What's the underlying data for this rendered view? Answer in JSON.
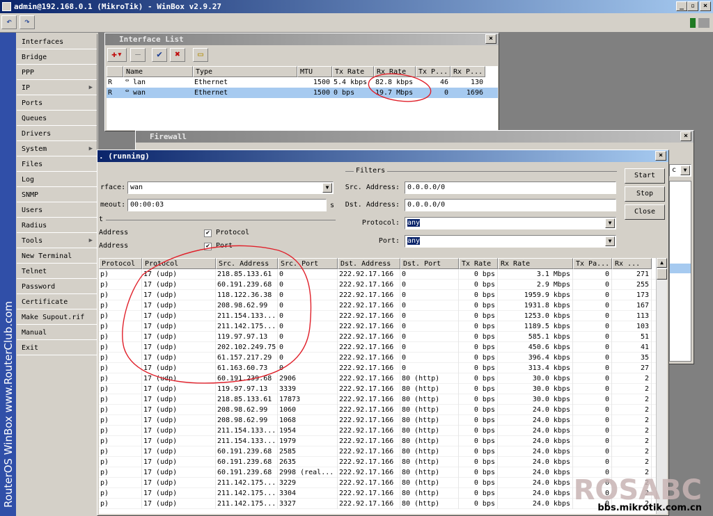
{
  "app": {
    "title": "admin@192.168.0.1 (MikroTik) - WinBox v2.9.27",
    "brand": "RouterOS WinBox  www.RouterClub.com",
    "watermark": "ROSABC",
    "watermark_url": "bbs.mikrotik.com.cn"
  },
  "sidebar": {
    "items": [
      {
        "label": "Interfaces",
        "sub": false
      },
      {
        "label": "Bridge",
        "sub": false
      },
      {
        "label": "PPP",
        "sub": false
      },
      {
        "label": "IP",
        "sub": true
      },
      {
        "label": "Ports",
        "sub": false
      },
      {
        "label": "Queues",
        "sub": false
      },
      {
        "label": "Drivers",
        "sub": false
      },
      {
        "label": "System",
        "sub": true
      },
      {
        "label": "Files",
        "sub": false
      },
      {
        "label": "Log",
        "sub": false
      },
      {
        "label": "SNMP",
        "sub": false
      },
      {
        "label": "Users",
        "sub": false
      },
      {
        "label": "Radius",
        "sub": false
      },
      {
        "label": "Tools",
        "sub": true
      },
      {
        "label": "New Terminal",
        "sub": false
      },
      {
        "label": "Telnet",
        "sub": false
      },
      {
        "label": "Password",
        "sub": false
      },
      {
        "label": "Certificate",
        "sub": false
      },
      {
        "label": "Make Supout.rif",
        "sub": false
      },
      {
        "label": "Manual",
        "sub": false
      },
      {
        "label": "Exit",
        "sub": false
      }
    ]
  },
  "interface_list": {
    "title": "Interface List",
    "columns": [
      "",
      "Name",
      "Type",
      "MTU",
      "Tx Rate",
      "Rx Rate",
      "Tx P...",
      "Rx P..."
    ],
    "rows": [
      [
        "R",
        "lan",
        "Ethernet",
        "1500",
        "5.4 kbps",
        "82.8 kbps",
        "46",
        "130"
      ],
      [
        "R",
        "wan",
        "Ethernet",
        "1500",
        "0 bps",
        "19.7 Mbps",
        "0",
        "1696"
      ]
    ],
    "selected_row": 1
  },
  "firewall": {
    "title": "Firewall",
    "side_select": "c"
  },
  "torch": {
    "title": ". (running)",
    "interface_label": "rface:",
    "interface_value": "wan",
    "timeout_label": "meout:",
    "timeout_value": "00:00:03",
    "timeout_unit": "s",
    "collect_label": "t",
    "collect_src": "Address",
    "collect_dst": "Address",
    "collect_protocol": "Protocol",
    "collect_port": "Port",
    "filters_label": "Filters",
    "src_address_label": "Src. Address:",
    "src_address_value": "0.0.0.0/0",
    "dst_address_label": "Dst. Address:",
    "dst_address_value": "0.0.0.0/0",
    "protocol_label": "Protocol:",
    "protocol_value": "any",
    "port_label": "Port:",
    "port_value": "any",
    "buttons": {
      "start": "Start",
      "stop": "Stop",
      "close": "Close"
    },
    "columns": [
      "Protocol",
      "Protocol",
      "Src. Address",
      "Src. Port",
      "Dst. Address",
      "Dst. Port",
      "Tx Rate",
      "Rx Rate",
      "Tx Pa...",
      "Rx ..."
    ],
    "rows": [
      [
        "p)",
        "17 (udp)",
        "218.85.133.61",
        "0",
        "222.92.17.166",
        "0",
        "0 bps",
        "3.1 Mbps",
        "0",
        "271"
      ],
      [
        "p)",
        "17 (udp)",
        "60.191.239.68",
        "0",
        "222.92.17.166",
        "0",
        "0 bps",
        "2.9 Mbps",
        "0",
        "255"
      ],
      [
        "p)",
        "17 (udp)",
        "118.122.36.38",
        "0",
        "222.92.17.166",
        "0",
        "0 bps",
        "1959.9 kbps",
        "0",
        "173"
      ],
      [
        "p)",
        "17 (udp)",
        "208.98.62.99",
        "0",
        "222.92.17.166",
        "0",
        "0 bps",
        "1931.8 kbps",
        "0",
        "167"
      ],
      [
        "p)",
        "17 (udp)",
        "211.154.133...",
        "0",
        "222.92.17.166",
        "0",
        "0 bps",
        "1253.0 kbps",
        "0",
        "113"
      ],
      [
        "p)",
        "17 (udp)",
        "211.142.175...",
        "0",
        "222.92.17.166",
        "0",
        "0 bps",
        "1189.5 kbps",
        "0",
        "103"
      ],
      [
        "p)",
        "17 (udp)",
        "119.97.97.13",
        "0",
        "222.92.17.166",
        "0",
        "0 bps",
        "585.1 kbps",
        "0",
        "51"
      ],
      [
        "p)",
        "17 (udp)",
        "202.102.249.75",
        "0",
        "222.92.17.166",
        "0",
        "0 bps",
        "450.6 kbps",
        "0",
        "41"
      ],
      [
        "p)",
        "17 (udp)",
        "61.157.217.29",
        "0",
        "222.92.17.166",
        "0",
        "0 bps",
        "396.4 kbps",
        "0",
        "35"
      ],
      [
        "p)",
        "17 (udp)",
        "61.163.60.73",
        "0",
        "222.92.17.166",
        "0",
        "0 bps",
        "313.4 kbps",
        "0",
        "27"
      ],
      [
        "p)",
        "17 (udp)",
        "60.191.239.68",
        "2906",
        "222.92.17.166",
        "80 (http)",
        "0 bps",
        "30.0 kbps",
        "0",
        "2"
      ],
      [
        "p)",
        "17 (udp)",
        "119.97.97.13",
        "3339",
        "222.92.17.166",
        "80 (http)",
        "0 bps",
        "30.0 kbps",
        "0",
        "2"
      ],
      [
        "p)",
        "17 (udp)",
        "218.85.133.61",
        "17873",
        "222.92.17.166",
        "80 (http)",
        "0 bps",
        "30.0 kbps",
        "0",
        "2"
      ],
      [
        "p)",
        "17 (udp)",
        "208.98.62.99",
        "1060",
        "222.92.17.166",
        "80 (http)",
        "0 bps",
        "24.0 kbps",
        "0",
        "2"
      ],
      [
        "p)",
        "17 (udp)",
        "208.98.62.99",
        "1068",
        "222.92.17.166",
        "80 (http)",
        "0 bps",
        "24.0 kbps",
        "0",
        "2"
      ],
      [
        "p)",
        "17 (udp)",
        "211.154.133...",
        "1954",
        "222.92.17.166",
        "80 (http)",
        "0 bps",
        "24.0 kbps",
        "0",
        "2"
      ],
      [
        "p)",
        "17 (udp)",
        "211.154.133...",
        "1979",
        "222.92.17.166",
        "80 (http)",
        "0 bps",
        "24.0 kbps",
        "0",
        "2"
      ],
      [
        "p)",
        "17 (udp)",
        "60.191.239.68",
        "2585",
        "222.92.17.166",
        "80 (http)",
        "0 bps",
        "24.0 kbps",
        "0",
        "2"
      ],
      [
        "p)",
        "17 (udp)",
        "60.191.239.68",
        "2635",
        "222.92.17.166",
        "80 (http)",
        "0 bps",
        "24.0 kbps",
        "0",
        "2"
      ],
      [
        "p)",
        "17 (udp)",
        "60.191.239.68",
        "2998 (real...",
        "222.92.17.166",
        "80 (http)",
        "0 bps",
        "24.0 kbps",
        "0",
        "2"
      ],
      [
        "p)",
        "17 (udp)",
        "211.142.175...",
        "3229",
        "222.92.17.166",
        "80 (http)",
        "0 bps",
        "24.0 kbps",
        "0",
        "2"
      ],
      [
        "p)",
        "17 (udp)",
        "211.142.175...",
        "3304",
        "222.92.17.166",
        "80 (http)",
        "0 bps",
        "24.0 kbps",
        "0",
        "2"
      ],
      [
        "p)",
        "17 (udp)",
        "211.142.175...",
        "3327",
        "222.92.17.166",
        "80 (http)",
        "0 bps",
        "24.0 kbps",
        "0",
        "2"
      ]
    ]
  },
  "colors": {
    "titlebar_active": "#0a246a",
    "selection": "#a6caf0",
    "annotation": "#e0202a",
    "brand_strip": "#304fa8"
  }
}
